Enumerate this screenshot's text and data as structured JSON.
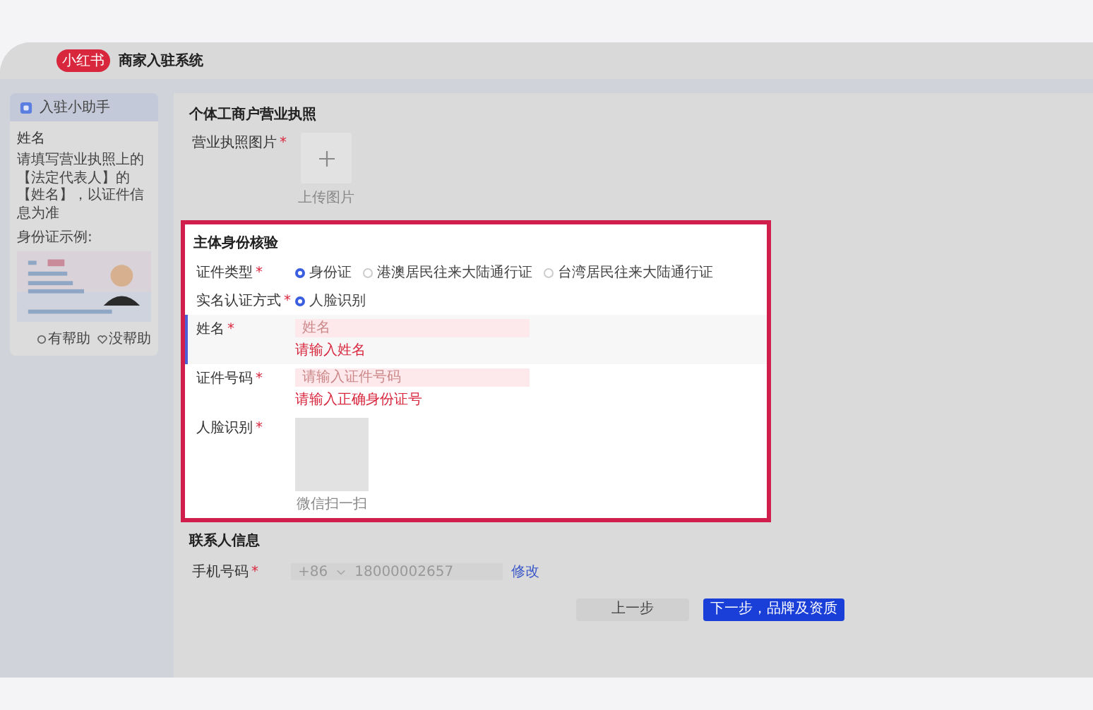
{
  "app": {
    "logo": "小红书",
    "title": "商家入驻系统"
  },
  "helper": {
    "title": "入驻小助手",
    "card_title": "姓名",
    "description": "请填写营业执照上的【法定代表人】的【姓名】，以证件信息为准",
    "example_label": "身份证示例:",
    "feedback": [
      {
        "label": "有帮助"
      },
      {
        "label": "没帮助"
      }
    ]
  },
  "license_section": {
    "title": "个体工商户营业执照",
    "field": {
      "label": "营业执照图片",
      "mark": "*",
      "upload_label": "上传图片"
    }
  },
  "identity_section": {
    "title": "主体身份核验",
    "highlighted": true,
    "fields": [
      {
        "kind": "radio",
        "label": "证件类型",
        "mark": "*",
        "options": [
          {
            "label": "身份证",
            "selected": true
          },
          {
            "label": "港澳居民往来大陆通行证",
            "selected": false
          },
          {
            "label": "台湾居民往来大陆通行证",
            "selected": false
          }
        ]
      },
      {
        "kind": "radio",
        "label": "实名认证方式",
        "mark": "*",
        "options": [
          {
            "label": "人脸识别",
            "selected": true
          }
        ]
      },
      {
        "kind": "input",
        "label": "姓名",
        "mark": "*",
        "placeholder": "姓名",
        "error": "请输入姓名",
        "focused": true
      },
      {
        "kind": "input",
        "label": "证件号码",
        "mark": "*",
        "placeholder": "请输入证件号码",
        "error": "请输入正确身份证号",
        "focused": false
      },
      {
        "kind": "qr",
        "label": "人脸识别",
        "mark": "*",
        "caption": "微信扫一扫"
      }
    ]
  },
  "contact_section": {
    "title": "联系人信息",
    "phone": {
      "label": "手机号码",
      "mark": "*",
      "country_code": "+86",
      "value": "18000002657",
      "action": "修改"
    }
  },
  "buttons": [
    {
      "label": "上一步",
      "kind": "secondary"
    },
    {
      "label": "下一步，品牌及资质",
      "kind": "primary"
    }
  ]
}
